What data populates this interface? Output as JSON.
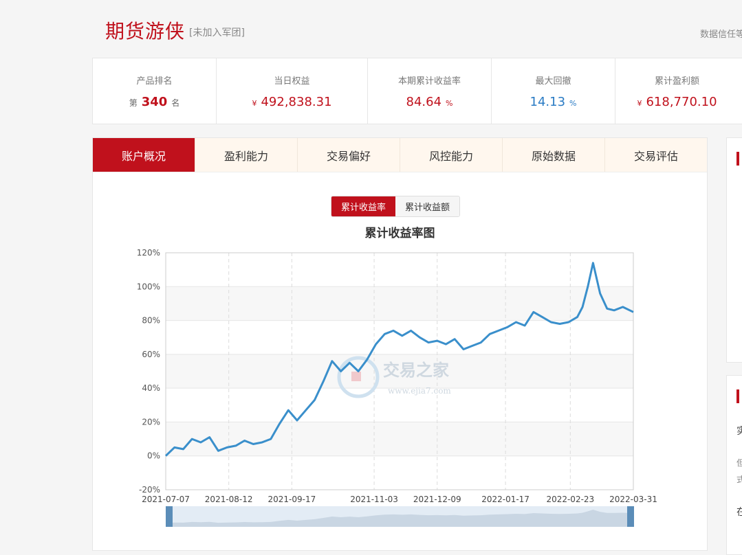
{
  "header": {
    "title": "期货游侠",
    "subtitle": "[未加入军团]",
    "trust_text": "数据信任等"
  },
  "stats": {
    "rank": {
      "label": "产品排名",
      "prefix": "第",
      "value": "340",
      "suffix": "名"
    },
    "equity": {
      "label": "当日权益",
      "currency": "¥",
      "value": "492,838.31"
    },
    "return_rate": {
      "label": "本期累计收益率",
      "value": "84.64",
      "unit": "%"
    },
    "drawdown": {
      "label": "最大回撤",
      "value": "14.13",
      "unit": "%"
    },
    "profit": {
      "label": "累计盈利额",
      "currency": "¥",
      "value": "618,770.10"
    }
  },
  "tabs": [
    "账户概况",
    "盈利能力",
    "交易偏好",
    "风控能力",
    "原始数据",
    "交易评估"
  ],
  "toggle": {
    "rate_label": "累计收益率",
    "amount_label": "累计收益额"
  },
  "watermark": {
    "name": "交易之家",
    "url": "www.ejia7.com"
  },
  "sidebar": {
    "chars": [
      "实",
      "但",
      "式",
      "在"
    ]
  },
  "colors": {
    "accent": "#c0111c",
    "line": "#3a8fcb",
    "blue_value": "#2a7bc4"
  },
  "chart_data": {
    "type": "line",
    "title": "累计收益率图",
    "ylim": [
      -20,
      120
    ],
    "y_ticks": [
      "120%",
      "100%",
      "80%",
      "60%",
      "40%",
      "20%",
      "0%",
      "-20%"
    ],
    "x_ticks": [
      "2021-07-07",
      "2021-08-12",
      "2021-09-17",
      "2021-11-03",
      "2021-12-09",
      "2022-01-17",
      "2022-02-23",
      "2022-03-31"
    ],
    "x_range": [
      "2021-07-07",
      "2022-03-31"
    ],
    "grid": true,
    "series": [
      {
        "x": [
          "2021-07-07",
          "2021-07-12",
          "2021-07-17",
          "2021-07-22",
          "2021-07-27",
          "2021-08-01",
          "2021-08-06",
          "2021-08-11",
          "2021-08-16",
          "2021-08-21",
          "2021-08-26",
          "2021-08-31",
          "2021-09-05",
          "2021-09-10",
          "2021-09-15",
          "2021-09-20",
          "2021-09-25",
          "2021-09-30",
          "2021-10-05",
          "2021-10-10",
          "2021-10-15",
          "2021-10-20",
          "2021-10-25",
          "2021-10-30",
          "2021-11-04",
          "2021-11-09",
          "2021-11-14",
          "2021-11-19",
          "2021-11-24",
          "2021-11-29",
          "2021-12-04",
          "2021-12-09",
          "2021-12-14",
          "2021-12-19",
          "2021-12-24",
          "2021-12-29",
          "2022-01-03",
          "2022-01-08",
          "2022-01-13",
          "2022-01-18",
          "2022-01-23",
          "2022-01-28",
          "2022-02-02",
          "2022-02-07",
          "2022-02-12",
          "2022-02-17",
          "2022-02-22",
          "2022-02-27",
          "2022-03-02",
          "2022-03-05",
          "2022-03-08",
          "2022-03-12",
          "2022-03-16",
          "2022-03-20",
          "2022-03-25",
          "2022-03-31"
        ],
        "y": [
          0,
          5,
          4,
          10,
          8,
          11,
          3,
          5,
          6,
          9,
          7,
          8,
          10,
          19,
          27,
          21,
          27,
          33,
          44,
          56,
          50,
          55,
          50,
          57,
          66,
          72,
          74,
          71,
          74,
          70,
          67,
          68,
          66,
          69,
          63,
          65,
          67,
          72,
          74,
          76,
          79,
          77,
          85,
          82,
          79,
          78,
          79,
          82,
          88,
          100,
          114,
          96,
          87,
          86,
          88,
          85
        ]
      }
    ]
  }
}
